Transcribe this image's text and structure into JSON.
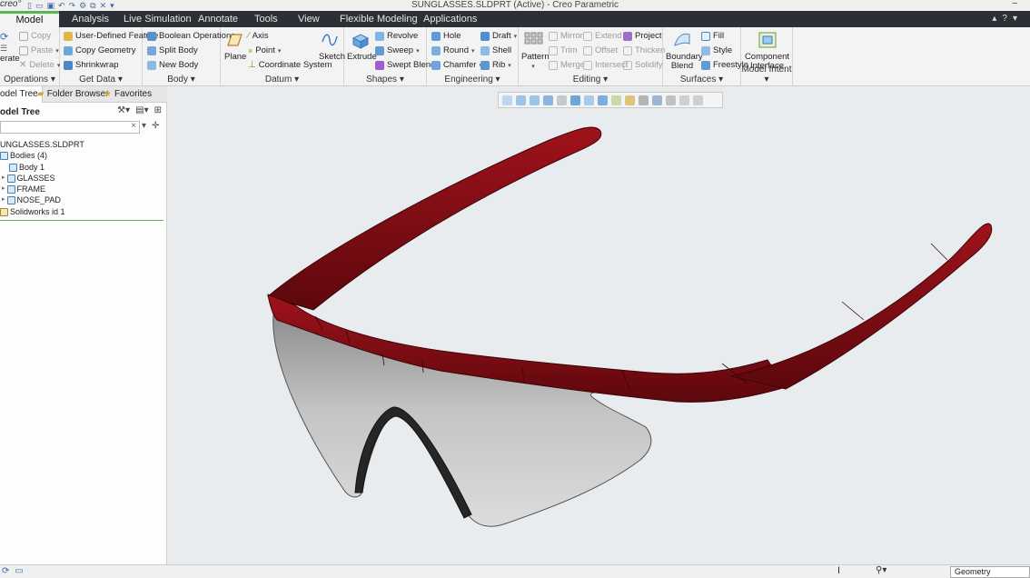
{
  "app": {
    "logo": "creo°",
    "window_title": "SUNGLASSES.SLDPRT (Active) - Creo Parametric",
    "window_controls": "–"
  },
  "menu_tabs": [
    "Model",
    "Analysis",
    "Live Simulation",
    "Annotate",
    "Tools",
    "View",
    "Flexible Modeling",
    "Applications"
  ],
  "ribbon": {
    "operations": {
      "label": "Operations",
      "regenerate": "erate",
      "copy": "Copy",
      "paste": "Paste",
      "delete": "Delete"
    },
    "get_data": {
      "label": "Get Data",
      "udf": "User-Defined Feature",
      "copy_geometry": "Copy Geometry",
      "shrinkwrap": "Shrinkwrap"
    },
    "body": {
      "label": "Body",
      "boolean": "Boolean Operations",
      "split": "Split Body",
      "new": "New Body"
    },
    "datum": {
      "label": "Datum",
      "plane": "Plane",
      "axis": "Axis",
      "point": "Point",
      "csys": "Coordinate System",
      "sketch": "Sketch"
    },
    "shapes": {
      "label": "Shapes",
      "extrude": "Extrude",
      "revolve": "Revolve",
      "sweep": "Sweep",
      "swept_blend": "Swept Blend"
    },
    "engineering": {
      "label": "Engineering",
      "hole": "Hole",
      "round": "Round",
      "chamfer": "Chamfer",
      "draft": "Draft",
      "shell": "Shell",
      "rib": "Rib"
    },
    "editing": {
      "label": "Editing",
      "pattern": "Pattern",
      "mirror": "Mirror",
      "trim": "Trim",
      "merge": "Merge",
      "extend": "Extend",
      "offset": "Offset",
      "intersect": "Intersect",
      "project": "Project",
      "thicken": "Thicken",
      "solidify": "Solidify"
    },
    "surfaces": {
      "label": "Surfaces",
      "boundary_blend": "Boundary Blend",
      "fill": "Fill",
      "style": "Style",
      "freestyle": "Freestyle"
    },
    "model_intent": {
      "label": "Model Intent",
      "component_interface": "Component Interface"
    }
  },
  "panel": {
    "tabs": [
      "odel Tree",
      "Folder Browser",
      "Favorites"
    ],
    "header": "odel Tree",
    "tree": [
      {
        "label": "UNGLASSES.SLDPRT",
        "indent": 0
      },
      {
        "label": "Bodies (4)",
        "indent": 1
      },
      {
        "label": "Body 1",
        "indent": 2
      },
      {
        "label": "GLASSES",
        "indent": 2
      },
      {
        "label": "FRAME",
        "indent": 2
      },
      {
        "label": "NOSE_PAD",
        "indent": 2
      },
      {
        "label": "Solidworks id 1",
        "indent": 1
      }
    ]
  },
  "status": {
    "filter": "Geometry"
  },
  "colors": {
    "frame": "#7b0e14",
    "lens": "#b9b9b9",
    "accent": "#54b948"
  }
}
